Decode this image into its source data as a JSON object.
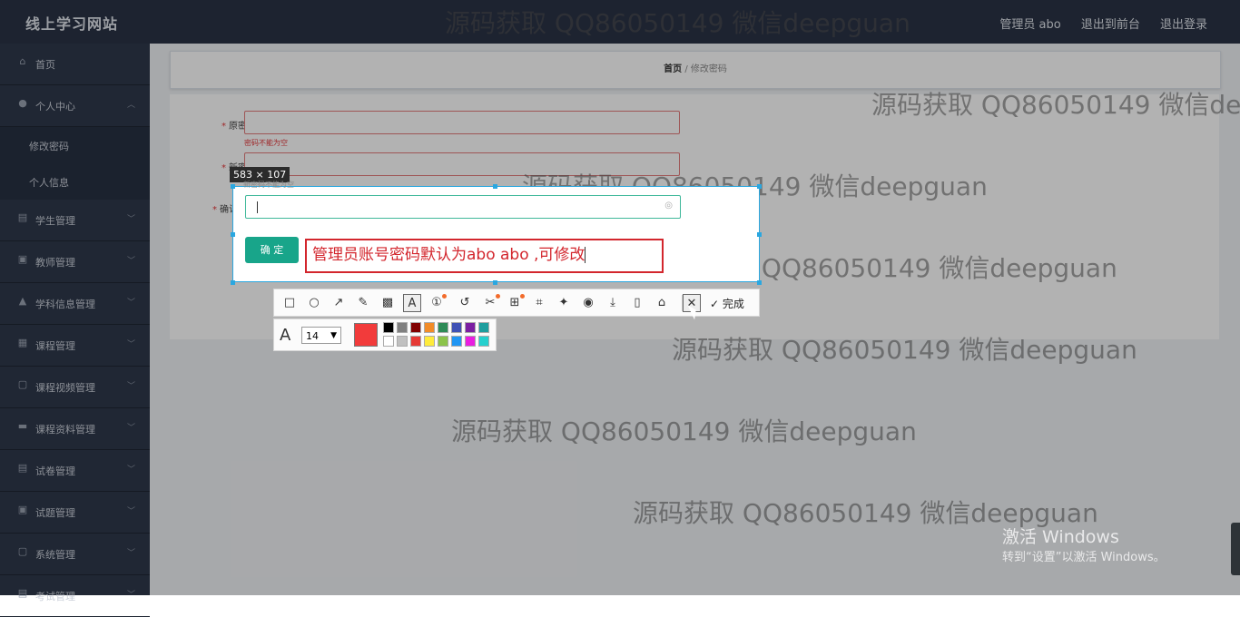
{
  "header": {
    "site_title": "线上学习网站",
    "user_label": "管理员 abo",
    "back_front": "退出到前台",
    "logout": "退出登录"
  },
  "sidebar": {
    "items": [
      {
        "label": "首页",
        "icon": "home-icon",
        "glyph": "⌂"
      },
      {
        "label": "个人中心",
        "icon": "user-icon",
        "glyph": "●",
        "children": [
          "修改密码",
          "个人信息"
        ]
      },
      {
        "label": "学生管理",
        "icon": "student-icon",
        "glyph": "▤"
      },
      {
        "label": "教师管理",
        "icon": "teacher-icon",
        "glyph": "▣"
      },
      {
        "label": "学科信息管理",
        "icon": "subject-icon",
        "glyph": "▲"
      },
      {
        "label": "课程管理",
        "icon": "course-icon",
        "glyph": "▦"
      },
      {
        "label": "课程视频管理",
        "icon": "video-icon",
        "glyph": "▢"
      },
      {
        "label": "课程资料管理",
        "icon": "material-icon",
        "glyph": "▬"
      },
      {
        "label": "试卷管理",
        "icon": "paper-icon",
        "glyph": "▤"
      },
      {
        "label": "试题管理",
        "icon": "question-icon",
        "glyph": "▣"
      },
      {
        "label": "系统管理",
        "icon": "system-icon",
        "glyph": "▢"
      },
      {
        "label": "考试管理",
        "icon": "exam-icon",
        "glyph": "▤"
      }
    ]
  },
  "breadcrumb": {
    "home": "首页",
    "sep": "/",
    "current": "修改密码"
  },
  "form": {
    "old_password_label": "原密码",
    "old_password_error": "密码不能为空",
    "new_password_label": "新密码",
    "new_password_error": "新密码不能为空",
    "confirm_label": "确认密码",
    "submit_label": "确 定"
  },
  "capture": {
    "size_label": "583 × 107",
    "annotation_text": "管理员账号密码默认为abo abo ,可修改",
    "done_label": "完成",
    "font_size": "14",
    "current_color": "#f23b3b",
    "palette_top": [
      "#000000",
      "#808080",
      "#800000",
      "#f28c28",
      "#2e8b57",
      "#3f51b5",
      "#7b1fa2",
      "#1e9e9e"
    ],
    "palette_bottom": [
      "#ffffff",
      "#c0c0c0",
      "#e53935",
      "#ffeb3b",
      "#8bc34a",
      "#2196f3",
      "#e91ee0",
      "#26d0ce"
    ]
  },
  "watermark": "源码获取 QQ86050149 微信deepguan",
  "windows_activation": {
    "line1": "激活 Windows",
    "line2": "转到“设置”以激活 Windows。"
  }
}
